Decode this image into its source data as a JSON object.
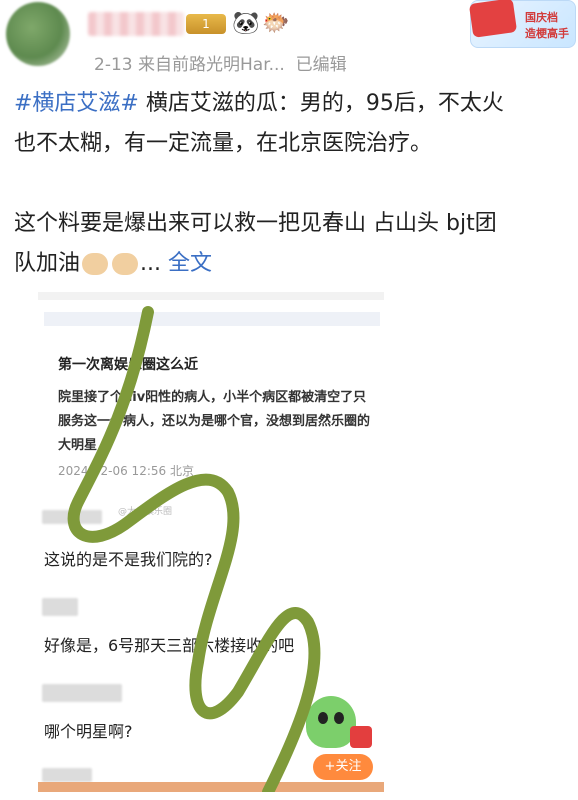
{
  "header": {
    "level_badge": "1",
    "emojis": [
      "panda-emoji",
      "pufferfish-emoji"
    ],
    "meta_prefix": "2-13  来自",
    "source": "前路光明Har...",
    "edited": "已编辑",
    "stamp_line1": "国庆档",
    "stamp_line2": "造梗高手"
  },
  "post": {
    "hashtag": "#横店艾滋#",
    "line1": " 横店艾滋的瓜：男的，95后，不太火",
    "line2": "也不太糊，有一定流量，在北京医院治疗。",
    "line3": "这个料要是爆出来可以救一把见春山 占山头 bjt团",
    "line4_prefix": "队加油",
    "line4_suffix": "...",
    "more_label": "全文"
  },
  "screenshot": {
    "card_title": "第一次离娱乐圈这么近",
    "card_body": "院里接了个hiv阳性的病人，小半个病区都被清空了只服务这一个病人，还以为是哪个官，没想到居然乐圈的大明星",
    "card_date": "2024-02-06 12:56 北京",
    "watermark": "@大瓜娱乐圈",
    "comments": [
      "这说的是不是我们院的?",
      "好像是，6号那天三部六楼接收的吧",
      "哪个明星啊?"
    ],
    "follow_label": "+关注"
  },
  "colors": {
    "accent_blue": "#3b6fc4",
    "squiggle": "#7f9a3a",
    "follow_orange": "#ff8a3d"
  }
}
